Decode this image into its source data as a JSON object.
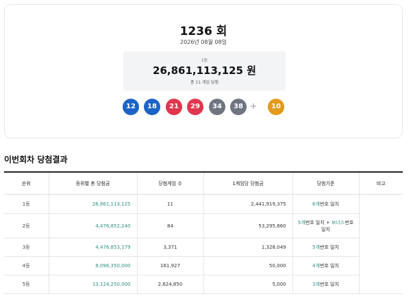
{
  "draw": {
    "number_label": "1236 회",
    "date": "2026년 08월 08일"
  },
  "first_prize": {
    "rank_label": "1등",
    "amount_label": "26,861,113,125 원",
    "winners_label": "총 11 게임 당첨"
  },
  "balls": [
    {
      "number": "12",
      "color": "#1d63c7"
    },
    {
      "number": "18",
      "color": "#1d63c7"
    },
    {
      "number": "21",
      "color": "#e0364e"
    },
    {
      "number": "29",
      "color": "#e0364e"
    },
    {
      "number": "34",
      "color": "#6f7580"
    },
    {
      "number": "38",
      "color": "#6f7580"
    }
  ],
  "plus_symbol": "+",
  "bonus_ball": {
    "number": "10",
    "color": "#e39a1b"
  },
  "section_title": "이번회차 당첨결과",
  "table": {
    "headers": [
      "순위",
      "등위별 총 당첨금",
      "당첨게임 수",
      "1게임당 당첨금",
      "당첨기준",
      "비고"
    ],
    "rows": [
      {
        "rank": "1등",
        "total": "26,861,113,125",
        "count": "11",
        "per_game": "2,441,919,375",
        "crit_num": "6개",
        "crit_text": "번호 일치"
      },
      {
        "rank": "2등",
        "total": "4,476,852,240",
        "count": "84",
        "per_game": "53,295,860",
        "crit_num": "5개",
        "crit_text": "번호 일치 + ",
        "crit_bonus": "보너스",
        "crit_tail": "번호",
        "crit_line2": "일치"
      },
      {
        "rank": "3등",
        "total": "4,476,853,179",
        "count": "3,371",
        "per_game": "1,328,049",
        "crit_num": "5개",
        "crit_text": "번호 일치"
      },
      {
        "rank": "4등",
        "total": "8,096,350,000",
        "count": "161,927",
        "per_game": "50,000",
        "crit_num": "4개",
        "crit_text": "번호 일치"
      },
      {
        "rank": "5등",
        "total": "13,124,250,000",
        "count": "2,624,850",
        "per_game": "5,000",
        "crit_num": "3개",
        "crit_text": "번호 일치"
      }
    ]
  },
  "colors": {
    "accent_teal": "#2f8f7f"
  }
}
